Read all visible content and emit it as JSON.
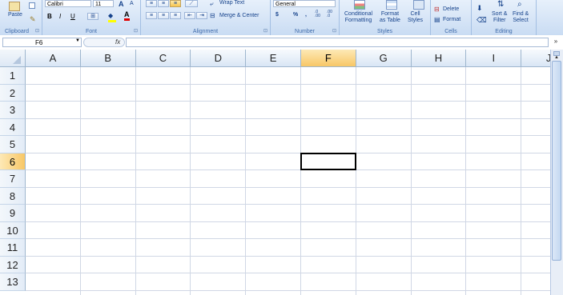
{
  "ribbon": {
    "clipboard": {
      "paste_label": "Paste",
      "group_label": "Clipboard"
    },
    "font": {
      "name": "Calibri",
      "size": "11",
      "bold": "B",
      "italic": "I",
      "underline": "U",
      "grow": "A",
      "shrink": "A",
      "font_color": "A",
      "group_label": "Font"
    },
    "alignment": {
      "wrap_text": "Wrap Text",
      "merge_center": "Merge & Center",
      "group_label": "Alignment"
    },
    "number": {
      "format": "General",
      "currency": "$",
      "percent": "%",
      "comma": ",",
      "inc_decimal": ".0 .00",
      "dec_decimal": ".00 .0",
      "group_label": "Number"
    },
    "styles": {
      "conditional_1": "Conditional",
      "conditional_2": "Formatting",
      "format_table_1": "Format",
      "format_table_2": "as Table",
      "cell_styles_1": "Cell",
      "cell_styles_2": "Styles",
      "group_label": "Styles"
    },
    "cells": {
      "delete": "Delete",
      "format": "Format",
      "group_label": "Cells"
    },
    "editing": {
      "sort_filter_1": "Sort &",
      "sort_filter_2": "Filter",
      "find_select_1": "Find &",
      "find_select_2": "Select",
      "group_label": "Editing"
    }
  },
  "formula_bar": {
    "name_box": "F6",
    "fx": "fx",
    "value": ""
  },
  "sheet": {
    "columns": [
      "A",
      "B",
      "C",
      "D",
      "E",
      "F",
      "G",
      "H",
      "I",
      "J"
    ],
    "rows": [
      "1",
      "2",
      "3",
      "4",
      "5",
      "6",
      "7",
      "8",
      "9",
      "10",
      "11",
      "12",
      "13"
    ],
    "active_cell": "F6"
  }
}
